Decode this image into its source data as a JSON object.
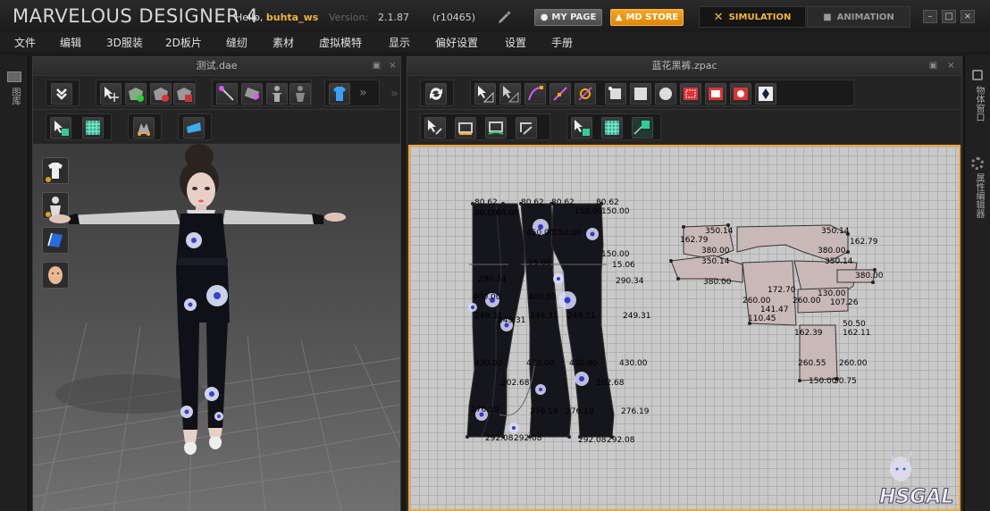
{
  "app": {
    "logo": "MARVELOUS DESIGNER 4",
    "greeting": "Hello,",
    "username": "buhta_ws",
    "version_label": "Version:",
    "version": "2.1.87",
    "build": "(r10465)",
    "mypage_label": "MY PAGE",
    "store_label": "MD STORE",
    "simulation_label": "SIMULATION",
    "animation_label": "ANIMATION",
    "accent_color": "#f4b830",
    "store_color": "#f59a10"
  },
  "menu": [
    "文件",
    "编辑",
    "3D服装",
    "2D板片",
    "缝纫",
    "素材",
    "虚拟模特",
    "显示",
    "偏好设置",
    "设置",
    "手册"
  ],
  "left_strip": {
    "label": "图库"
  },
  "right_strip": {
    "label1": "物体窗口",
    "label2": "属性编辑器"
  },
  "panel3d": {
    "title": "测试.dae"
  },
  "panel2d": {
    "title": "蓝花黑裤.zpac"
  },
  "measurements": [
    "80.62",
    "80.62",
    "80.62",
    "80.62",
    "80.00",
    "80.00",
    "150.00",
    "150.00",
    "450.00",
    "150.00",
    "150.00",
    "15.06",
    "15.06",
    "290.34",
    "290.34",
    "400.00",
    "400.00",
    "249.31",
    "249.31",
    "249.31",
    "249.31",
    "249.31",
    "430.00",
    "430.00",
    "430.00",
    "430.00",
    "202.68",
    "202.68",
    "276.19",
    "276.19",
    "276.19",
    "276.19",
    "292.08",
    "292.08",
    "292.08",
    "292.08",
    "350.14",
    "350.14",
    "350.14",
    "350.14",
    "162.79",
    "162.79",
    "380.00",
    "380.00",
    "380.00",
    "380.00",
    "260.00",
    "260.00",
    "260.55",
    "260.00",
    "150.00",
    "50.75",
    "110.45",
    "141.47",
    "130.00",
    "162.39",
    "162.11",
    "50.50",
    "107.26",
    "172.70"
  ]
}
